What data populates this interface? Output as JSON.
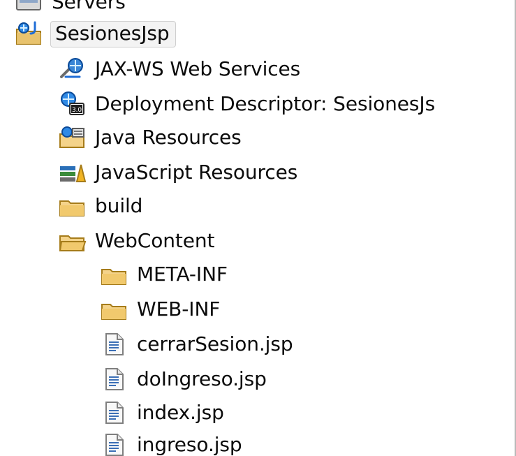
{
  "tree": {
    "partial_top": {
      "label": "Servers"
    },
    "project": {
      "label": "SesionesJsp",
      "selected": true
    },
    "items": [
      {
        "label": "JAX-WS Web Services",
        "icon": "jax-ws-services-icon"
      },
      {
        "label": "Deployment Descriptor: SesionesJs",
        "icon": "deployment-descriptor-icon"
      },
      {
        "label": "Java Resources",
        "icon": "java-resources-icon"
      },
      {
        "label": "JavaScript Resources",
        "icon": "javascript-resources-icon"
      },
      {
        "label": "build",
        "icon": "folder-icon"
      },
      {
        "label": "WebContent",
        "icon": "folder-open-icon"
      },
      {
        "label": "META-INF",
        "icon": "folder-icon"
      },
      {
        "label": "WEB-INF",
        "icon": "folder-icon"
      },
      {
        "label": "cerrarSesion.jsp",
        "icon": "jsp-file-icon"
      },
      {
        "label": "doIngreso.jsp",
        "icon": "jsp-file-icon"
      },
      {
        "label": "index.jsp",
        "icon": "jsp-file-icon"
      },
      {
        "label": "ingreso.jsp",
        "icon": "jsp-file-icon"
      }
    ]
  },
  "colors": {
    "folder_fill": "#f4d38a",
    "folder_stroke": "#a67c1a",
    "file_fill": "#f8f8f8",
    "file_stroke": "#7f7f7f",
    "accent_blue": "#1f6dd6",
    "selection_border": "#cfcfcf"
  }
}
